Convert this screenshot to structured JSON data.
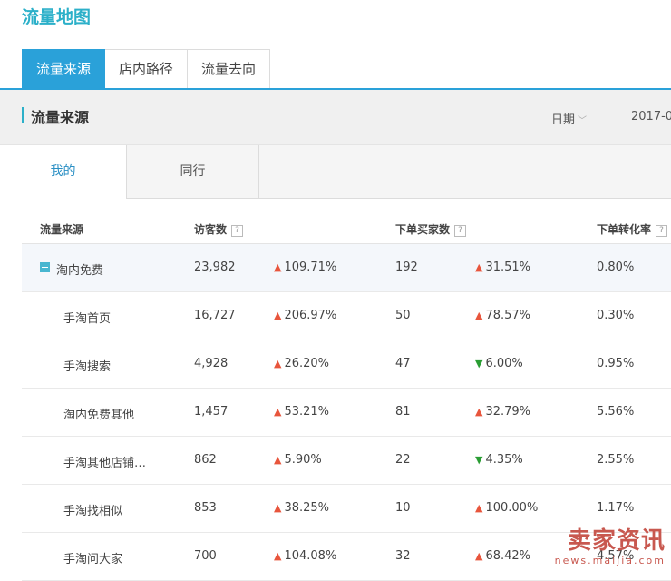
{
  "page_title": "流量地图",
  "main_tabs": [
    {
      "label": "流量来源",
      "active": true
    },
    {
      "label": "店内路径",
      "active": false
    },
    {
      "label": "流量去向",
      "active": false
    }
  ],
  "section": {
    "title": "流量来源",
    "date_label": "日期",
    "date_value": "2017-0"
  },
  "sub_tabs": [
    {
      "label": "我的",
      "active": true
    },
    {
      "label": "同行",
      "active": false
    }
  ],
  "table": {
    "headers": {
      "source": "流量来源",
      "visitors": "访客数",
      "buyers": "下单买家数",
      "rate": "下单转化率",
      "help": "?"
    },
    "rows": [
      {
        "name": "淘内免费",
        "visitors": "23,982",
        "visitors_trend": "up",
        "visitors_change": "109.71%",
        "buyers": "192",
        "buyers_trend": "up",
        "buyers_change": "31.51%",
        "rate": "0.80%"
      },
      {
        "name": "手淘首页",
        "visitors": "16,727",
        "visitors_trend": "up",
        "visitors_change": "206.97%",
        "buyers": "50",
        "buyers_trend": "up",
        "buyers_change": "78.57%",
        "rate": "0.30%"
      },
      {
        "name": "手淘搜索",
        "visitors": "4,928",
        "visitors_trend": "up",
        "visitors_change": "26.20%",
        "buyers": "47",
        "buyers_trend": "down",
        "buyers_change": "6.00%",
        "rate": "0.95%"
      },
      {
        "name": "淘内免费其他",
        "visitors": "1,457",
        "visitors_trend": "up",
        "visitors_change": "53.21%",
        "buyers": "81",
        "buyers_trend": "up",
        "buyers_change": "32.79%",
        "rate": "5.56%"
      },
      {
        "name": "手淘其他店铺…",
        "visitors": "862",
        "visitors_trend": "up",
        "visitors_change": "5.90%",
        "buyers": "22",
        "buyers_trend": "down",
        "buyers_change": "4.35%",
        "rate": "2.55%"
      },
      {
        "name": "手淘找相似",
        "visitors": "853",
        "visitors_trend": "up",
        "visitors_change": "38.25%",
        "buyers": "10",
        "buyers_trend": "up",
        "buyers_change": "100.00%",
        "rate": "1.17%"
      },
      {
        "name": "手淘问大家",
        "visitors": "700",
        "visitors_trend": "up",
        "visitors_change": "104.08%",
        "buyers": "32",
        "buyers_trend": "up",
        "buyers_change": "68.42%",
        "rate": "4.57%"
      }
    ]
  },
  "watermark": {
    "main": "卖家资讯",
    "sub": "news.maijia.com"
  },
  "colors": {
    "accent": "#2aa1d9",
    "title": "#2cb0c9",
    "up": "#e8553c",
    "down": "#2a9d33"
  }
}
